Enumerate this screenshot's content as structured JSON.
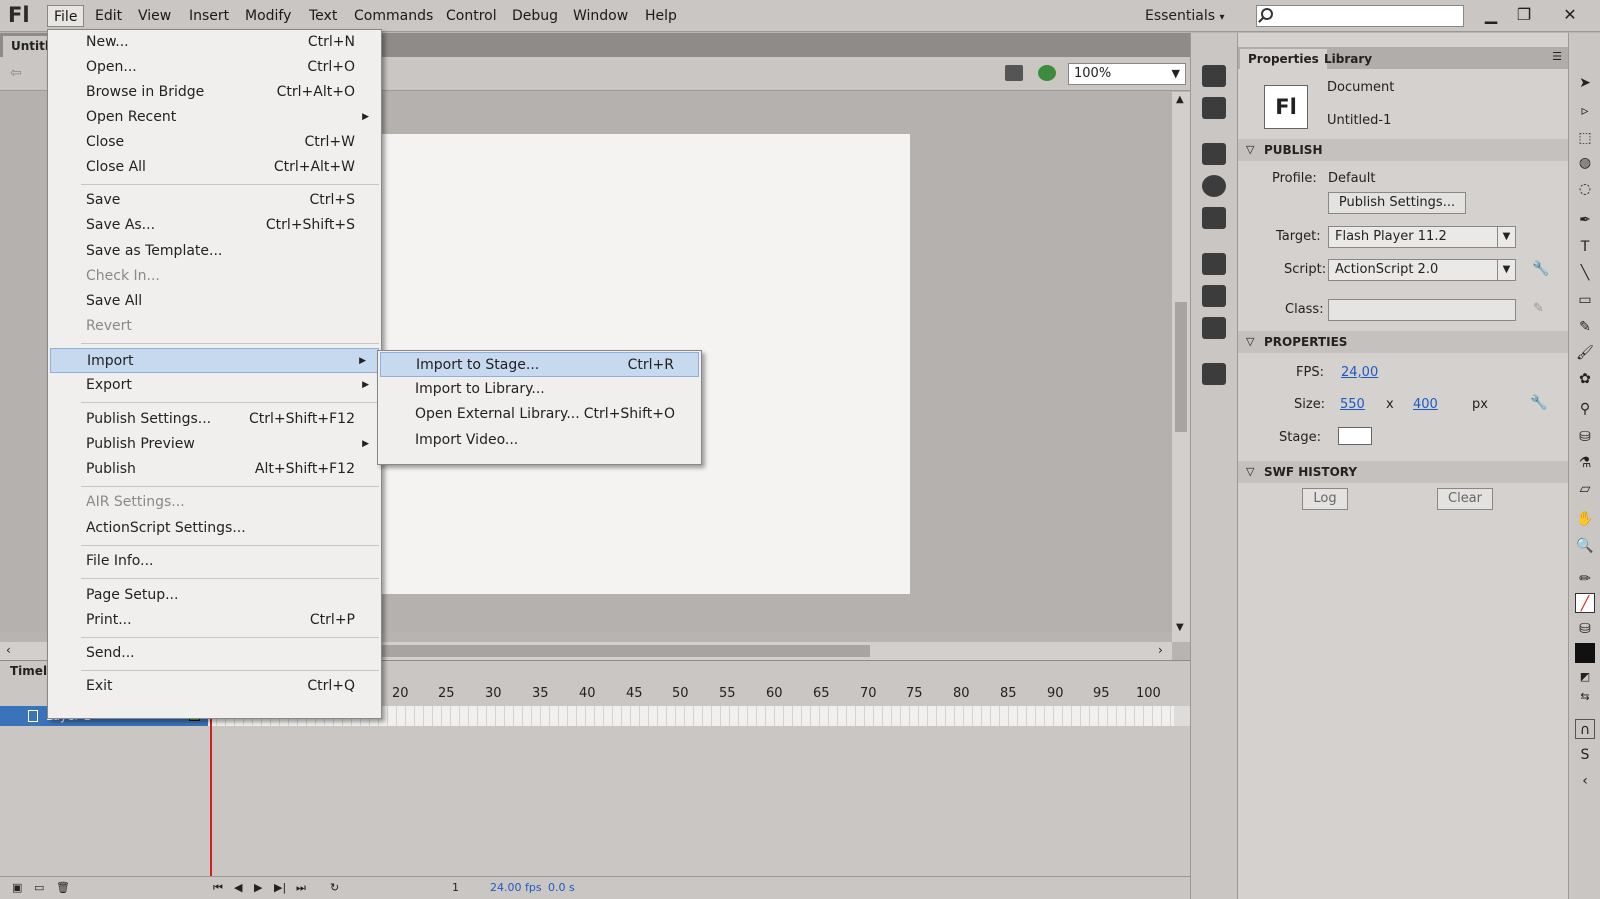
{
  "app": {
    "logo": "Fl",
    "workspace": "Essentials"
  },
  "menubar": [
    "File",
    "Edit",
    "View",
    "Insert",
    "Modify",
    "Text",
    "Commands",
    "Control",
    "Debug",
    "Window",
    "Help"
  ],
  "document_tab": "Untitled-1",
  "zoom": "100%",
  "file_menu": [
    {
      "label": "New...",
      "shortcut": "Ctrl+N"
    },
    {
      "label": "Open...",
      "shortcut": "Ctrl+O"
    },
    {
      "label": "Browse in Bridge",
      "shortcut": "Ctrl+Alt+O"
    },
    {
      "label": "Open Recent",
      "shortcut": ""
    },
    {
      "label": "Close",
      "shortcut": "Ctrl+W"
    },
    {
      "label": "Close All",
      "shortcut": "Ctrl+Alt+W"
    },
    {
      "label": "Save",
      "shortcut": "Ctrl+S"
    },
    {
      "label": "Save As...",
      "shortcut": "Ctrl+Shift+S"
    },
    {
      "label": "Save as Template...",
      "shortcut": ""
    },
    {
      "label": "Check In...",
      "shortcut": ""
    },
    {
      "label": "Save All",
      "shortcut": ""
    },
    {
      "label": "Revert",
      "shortcut": ""
    },
    {
      "label": "Import",
      "shortcut": ""
    },
    {
      "label": "Export",
      "shortcut": ""
    },
    {
      "label": "Publish Settings...",
      "shortcut": "Ctrl+Shift+F12"
    },
    {
      "label": "Publish Preview",
      "shortcut": ""
    },
    {
      "label": "Publish",
      "shortcut": "Alt+Shift+F12"
    },
    {
      "label": "AIR Settings...",
      "shortcut": ""
    },
    {
      "label": "ActionScript Settings...",
      "shortcut": ""
    },
    {
      "label": "File Info...",
      "shortcut": ""
    },
    {
      "label": "Page Setup...",
      "shortcut": ""
    },
    {
      "label": "Print...",
      "shortcut": "Ctrl+P"
    },
    {
      "label": "Send...",
      "shortcut": ""
    },
    {
      "label": "Exit",
      "shortcut": "Ctrl+Q"
    }
  ],
  "import_menu": [
    {
      "label": "Import to Stage...",
      "shortcut": "Ctrl+R"
    },
    {
      "label": "Import to Library...",
      "shortcut": ""
    },
    {
      "label": "Open External Library...",
      "shortcut": "Ctrl+Shift+O"
    },
    {
      "label": "Import Video...",
      "shortcut": ""
    }
  ],
  "timeline": {
    "title": "Timeline",
    "layer_name": "Layer 1",
    "ruler": [
      "20",
      "25",
      "30",
      "35",
      "40",
      "45",
      "50",
      "55",
      "60",
      "65",
      "70",
      "75",
      "80",
      "85",
      "90",
      "95",
      "100"
    ],
    "current_frame": "1",
    "fps": "24.00 fps",
    "time": "0.0 s"
  },
  "properties": {
    "tabs": [
      "Properties",
      "Library"
    ],
    "doc_icon": "Fl",
    "doc_type": "Document",
    "doc_name": "Untitled-1",
    "publish_section": "PUBLISH",
    "profile_label": "Profile:",
    "profile_value": "Default",
    "publish_settings_btn": "Publish Settings...",
    "target_label": "Target:",
    "target_value": "Flash Player 11.2",
    "script_label": "Script:",
    "script_value": "ActionScript 2.0",
    "class_label": "Class:",
    "properties_section": "PROPERTIES",
    "fps_label": "FPS:",
    "fps_value": "24,00",
    "size_label": "Size:",
    "width": "550",
    "x_sep": "x",
    "height": "400",
    "unit": "px",
    "stage_label": "Stage:",
    "swf_section": "SWF HISTORY",
    "log_btn": "Log",
    "clear_btn": "Clear"
  },
  "colors": {
    "highlight": "#c7d9ef",
    "layer_selected": "#3a73b9",
    "playhead": "#d02020",
    "link": "#1d5bc4"
  }
}
